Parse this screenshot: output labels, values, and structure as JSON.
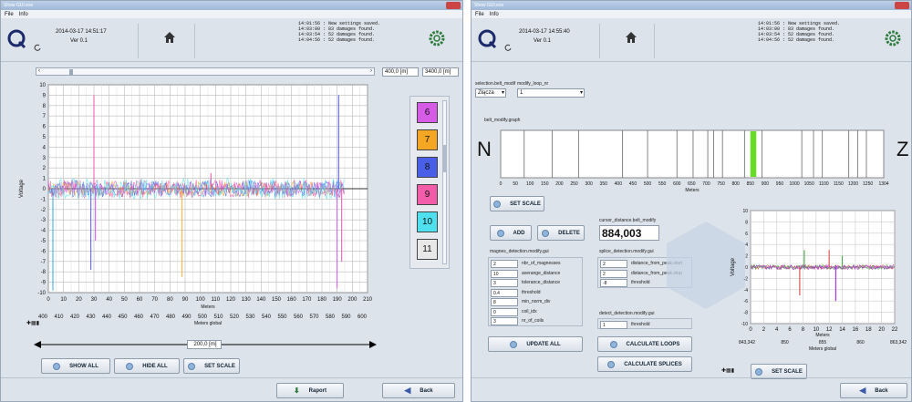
{
  "left": {
    "window_title": "Show GUI.exe",
    "menu": [
      "File",
      "Info"
    ],
    "datetime": "2014-03-17 14:51:17",
    "version": "Ver 0.1",
    "log": "14:01:56 : New settings saved.\n14:03:00 : 83 damages found.\n14:03:54 : 52 damages found.\n14:04:56 : 52 damages found.",
    "range_left": "400,0 [m]",
    "range_right": "3400,0 [m]",
    "chart_ylabel": "Voltage",
    "chart_xlabel_top": "Meters",
    "chart_xlabel_bottom": "Meters global",
    "width_label": "200,0 [m]",
    "buttons": {
      "show_all": "SHOW ALL",
      "hide_all": "HIDE ALL",
      "set_scale": "SET SCALE",
      "raport": "Raport",
      "back": "Back"
    },
    "channel_buttons": [
      {
        "label": "6",
        "color": "#d65ce8"
      },
      {
        "label": "7",
        "color": "#f5a623"
      },
      {
        "label": "8",
        "color": "#4a5fe8"
      },
      {
        "label": "9",
        "color": "#f25ca8"
      },
      {
        "label": "10",
        "color": "#4fe0ef"
      },
      {
        "label": "11",
        "color": "#e8e8e8"
      }
    ]
  },
  "right": {
    "window_title": "Show GUI.exe",
    "menu": [
      "File",
      "Info"
    ],
    "datetime": "2014-03-17 14:55:40",
    "version": "Ver 0.1",
    "log": "14:01:56 : New settings saved.\n14:03:00 : 83 damages found.\n14:03:54 : 52 damages found.\n14:04:56 : 52 damages found.",
    "selection_belt_label": "selection.belt_modif",
    "selection_belt_value": "Złącza",
    "modify_loop_label": "modify_loop_nr",
    "modify_loop_value": "1",
    "belt_graph_label": "belt_modify.graph",
    "belt_left": "N",
    "belt_right": "Z",
    "belt_xlabel": "Meters",
    "cursor_label": "cursor_distance.belt_modify",
    "cursor_value": "884,003",
    "magnes_title": "magnes_detection.modify.gui",
    "magnes_params": [
      {
        "value": "2",
        "name": "nbr_of_magnesses"
      },
      {
        "value": "10",
        "name": "averange_distance"
      },
      {
        "value": "3",
        "name": "tolerance_distance"
      },
      {
        "value": "0.4",
        "name": "threshold"
      },
      {
        "value": "8",
        "name": "min_norm_div"
      },
      {
        "value": "0",
        "name": "coil_idx"
      },
      {
        "value": "3",
        "name": "nr_of_coils"
      }
    ],
    "splice_title": "splice_detection.modify.gui",
    "splice_params": [
      {
        "value": "2",
        "name": "distance_from_peak.start"
      },
      {
        "value": "2",
        "name": "distance_from_peak.stop"
      },
      {
        "value": "-8",
        "name": "threshold"
      }
    ],
    "detect_title": "detect_detection.modify.gui",
    "detect_params": [
      {
        "value": "1",
        "name": "threshold"
      }
    ],
    "chart_ylabel": "Voltage",
    "chart_xlabel_top": "Meters",
    "chart_xlabel_bottom": "Meters global",
    "global_ticks": [
      "843,342",
      "850",
      "855",
      "860",
      "863,342"
    ],
    "buttons": {
      "set_scale_top": "SET SCALE",
      "add": "ADD",
      "delete": "DELETE",
      "update_all": "UPDATE ALL",
      "calc_loops": "CALCULATE LOOPS",
      "calc_splices": "CALCULATE SPLICES",
      "set_scale_bottom": "SET SCALE",
      "back": "Back"
    }
  },
  "chart_data": [
    {
      "type": "line",
      "title": "",
      "xlabel": "Meters",
      "ylabel": "Voltage",
      "xlim": [
        0,
        210
      ],
      "ylim": [
        -10,
        10
      ],
      "x_ticks": [
        0,
        10,
        20,
        30,
        40,
        50,
        60,
        70,
        80,
        90,
        100,
        110,
        120,
        130,
        140,
        150,
        160,
        170,
        180,
        190,
        200,
        210
      ],
      "x2_ticks": [
        400,
        410,
        420,
        430,
        440,
        450,
        460,
        470,
        480,
        490,
        500,
        510,
        520,
        530,
        540,
        550,
        560,
        570,
        580,
        590,
        600
      ],
      "y_ticks": [
        10,
        9,
        8,
        7,
        6,
        5,
        4,
        3,
        2,
        1,
        0,
        -1,
        -2,
        -3,
        -4,
        -5,
        -6,
        -7,
        -8,
        -9,
        -10
      ],
      "spikes": [
        {
          "x": 3,
          "y": -9.8,
          "color": "#3ad"
        },
        {
          "x": 28,
          "y": -7.8,
          "color": "#55f"
        },
        {
          "x": 30,
          "y": 9,
          "color": "#e5a"
        },
        {
          "x": 31,
          "y": -5,
          "color": "#c5e"
        },
        {
          "x": 88,
          "y": -8.5,
          "color": "#fa3"
        },
        {
          "x": 107,
          "y": 1.5,
          "color": "#e5a"
        },
        {
          "x": 190,
          "y": -9.6,
          "color": "#c5e"
        },
        {
          "x": 191,
          "y": 9,
          "color": "#55f"
        },
        {
          "x": 193,
          "y": -7,
          "color": "#e5a"
        }
      ],
      "series_colors": [
        "#d65ce8",
        "#f5a623",
        "#4a5fe8",
        "#f25ca8",
        "#4fe0ef"
      ]
    },
    {
      "type": "bar",
      "title": "",
      "xlabel": "Meters",
      "xlim": [
        0,
        1304
      ],
      "x_ticks": [
        0,
        50,
        100,
        150,
        200,
        250,
        300,
        350,
        400,
        450,
        500,
        550,
        600,
        650,
        700,
        750,
        800,
        850,
        900,
        950,
        1000,
        1050,
        1100,
        1150,
        1200,
        1250,
        1304
      ],
      "markers": [
        80,
        175,
        265,
        415,
        500,
        600,
        655,
        705,
        725,
        755,
        830,
        890,
        1025,
        1065,
        1095,
        1185,
        1215,
        1245
      ],
      "highlight": {
        "start": 850,
        "end": 870,
        "color": "#66dd22"
      }
    },
    {
      "type": "line",
      "title": "",
      "xlabel": "Meters",
      "ylabel": "Voltage",
      "xlim": [
        0,
        22
      ],
      "ylim": [
        -10,
        10
      ],
      "x_ticks": [
        0,
        2,
        4,
        6,
        8,
        10,
        12,
        14,
        16,
        18,
        20,
        22
      ],
      "y_ticks": [
        10,
        8,
        6,
        4,
        2,
        0,
        -2,
        -4,
        -6,
        -8,
        -10
      ],
      "spikes": [
        {
          "x": 7.5,
          "y": -5,
          "color": "#d55"
        },
        {
          "x": 8.2,
          "y": 3,
          "color": "#5a5"
        },
        {
          "x": 12,
          "y": 3,
          "color": "#d55"
        },
        {
          "x": 13,
          "y": -6,
          "color": "#a3d"
        },
        {
          "x": 14,
          "y": 2,
          "color": "#5a5"
        }
      ]
    }
  ]
}
